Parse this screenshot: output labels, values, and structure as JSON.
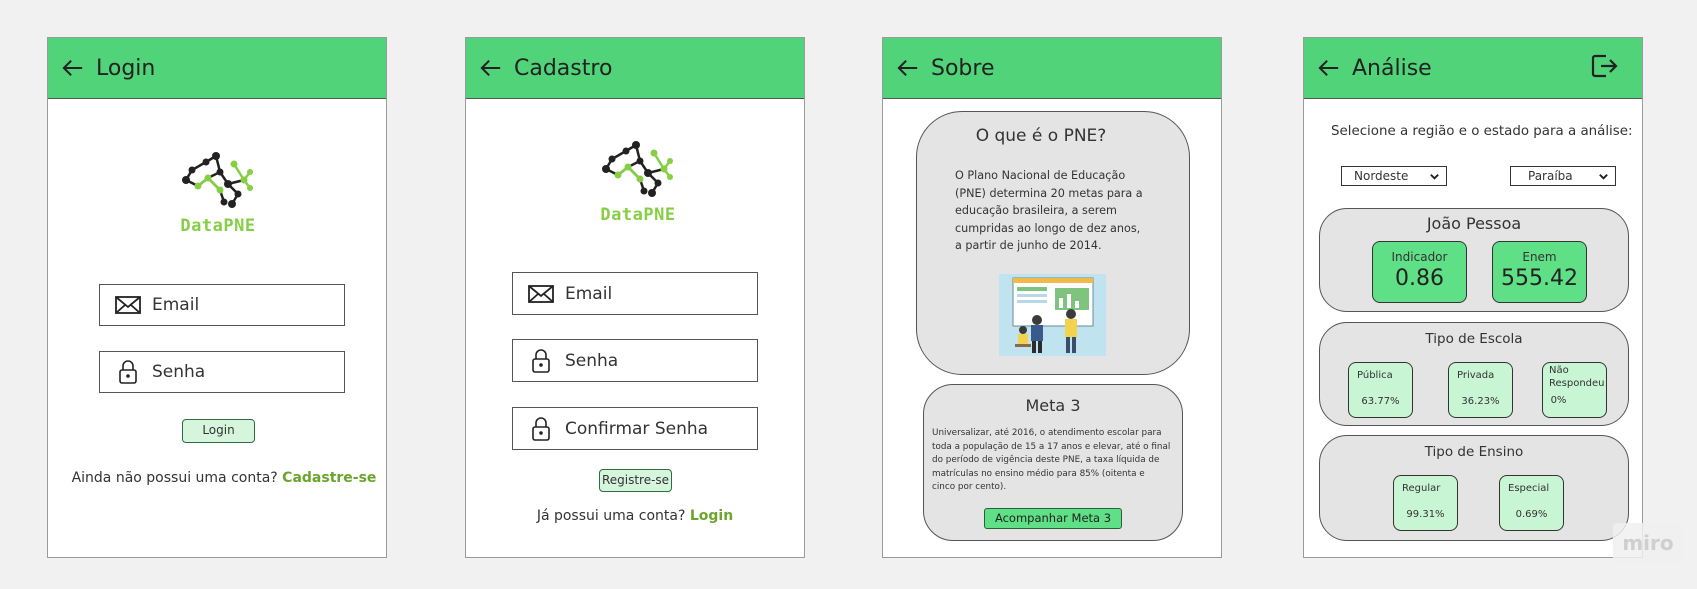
{
  "login": {
    "title": "Login",
    "logo_text": "DataPNE",
    "email_label": "Email",
    "password_label": "Senha",
    "button": "Login",
    "signup_prompt": "Ainda não possui uma conta?",
    "signup_link": "Cadastre-se"
  },
  "register": {
    "title": "Cadastro",
    "logo_text": "DataPNE",
    "email_label": "Email",
    "password_label": "Senha",
    "confirm_label": "Confirmar Senha",
    "button": "Registre-se",
    "login_prompt": "Já possui uma conta?",
    "login_link": "Login"
  },
  "about": {
    "title": "Sobre",
    "card1_title": "O que é o PNE?",
    "card1_lines": [
      "O Plano Nacional de Educação",
      "(PNE) determina 20 metas para a",
      "educação brasileira, a serem",
      "cumpridas ao longo de dez anos,",
      "a partir de junho de 2014."
    ],
    "card2_title": "Meta 3",
    "card2_lines": [
      "Universalizar, até 2016, o atendimento escolar para",
      "toda a população de 15 a 17 anos e elevar, até o final",
      "do período de vigência deste PNE, a taxa líquida de",
      "matrículas no ensino médio para 85% (oitenta e",
      "cinco por cento)."
    ],
    "card2_button": "Acompanhar Meta 3"
  },
  "analysis": {
    "title": "Análise",
    "instruction": "Selecione a região e o estado para a análise:",
    "region_value": "Nordeste",
    "state_value": "Paraíba",
    "city": "João Pessoa",
    "indicator_label": "Indicador",
    "indicator_value": "0.86",
    "enem_label": "Enem",
    "enem_value": "555.42",
    "school_type_title": "Tipo de Escola",
    "school_public_label": "Pública",
    "school_public_value": "63.77%",
    "school_private_label": "Privada",
    "school_private_value": "36.23%",
    "school_noanswer_label_1": "Não",
    "school_noanswer_label_2": "Respondeu",
    "school_noanswer_value": "0%",
    "teaching_type_title": "Tipo de Ensino",
    "teaching_regular_label": "Regular",
    "teaching_regular_value": "99.31%",
    "teaching_special_label": "Especial",
    "teaching_special_value": "0.69%"
  },
  "watermark": "miro",
  "colors": {
    "appbar": "#51d479",
    "logo_green": "#86cf45",
    "link_green": "#6ba52c",
    "stat_green": "#5fe086",
    "light_green": "#c8f5d4",
    "card_gray": "#e4e4e4"
  },
  "icons": [
    "arrow-left-icon",
    "logout-icon",
    "envelope-icon",
    "lock-icon",
    "chevron-down-icon",
    "network-logo"
  ]
}
